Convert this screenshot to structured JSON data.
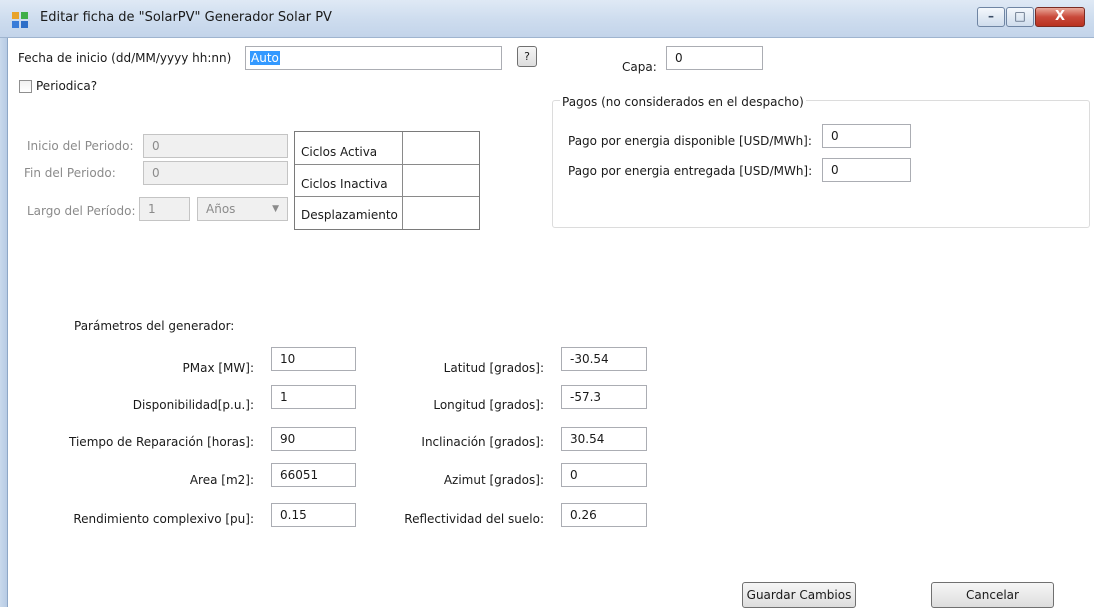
{
  "window": {
    "title": "Editar ficha de  \"SolarPV\" Generador Solar PV",
    "controls": {
      "minimize": "–",
      "maximize": "□",
      "close": "X"
    }
  },
  "header": {
    "fecha_label": "Fecha de inicio (dd/MM/yyyy hh:nn)",
    "fecha_value": "Auto",
    "help_label": "?",
    "capa_label": "Capa:",
    "capa_value": "0",
    "periodica_label": "Periodica?",
    "periodica_checked": false
  },
  "periodo": {
    "inicio_label": "Inicio del Periodo:",
    "inicio_value": "0",
    "fin_label": "Fin del Periodo:",
    "fin_value": "0",
    "largo_label": "Largo del Período:",
    "largo_value": "1",
    "unidad_value": "Años",
    "ciclos": [
      {
        "label": "Ciclos Activa",
        "value": ""
      },
      {
        "label": "Ciclos Inactiva",
        "value": ""
      },
      {
        "label": "Desplazamiento",
        "value": ""
      }
    ]
  },
  "pagos": {
    "title": "Pagos (no considerados en el despacho)",
    "disponible_label": "Pago por energia disponible [USD/MWh]:",
    "disponible_value": "0",
    "entregada_label": "Pago por energia entregada  [USD/MWh]:",
    "entregada_value": "0"
  },
  "parametros": {
    "title": "Parámetros del generador:",
    "left": [
      {
        "label": "PMax [MW]:",
        "value": "10"
      },
      {
        "label": "Disponibilidad[p.u.]:",
        "value": "1"
      },
      {
        "label": "Tiempo de Reparación [horas]:",
        "value": "90"
      },
      {
        "label": "Area [m2]:",
        "value": "66051"
      },
      {
        "label": "Rendimiento complexivo [pu]:",
        "value": "0.15"
      }
    ],
    "right": [
      {
        "label": "Latitud [grados]:",
        "value": "-30.54"
      },
      {
        "label": "Longitud [grados]:",
        "value": "-57.3"
      },
      {
        "label": "Inclinación [grados]:",
        "value": "30.54"
      },
      {
        "label": "Azimut [grados]:",
        "value": "0"
      },
      {
        "label": "Reflectividad del suelo:",
        "value": "0.26"
      }
    ]
  },
  "footer": {
    "save_label": "Guardar Cambios",
    "cancel_label": "Cancelar"
  },
  "colors": {
    "selection": "#3399ff",
    "titlebar": "#cddcee",
    "close_button": "#c9493a"
  }
}
